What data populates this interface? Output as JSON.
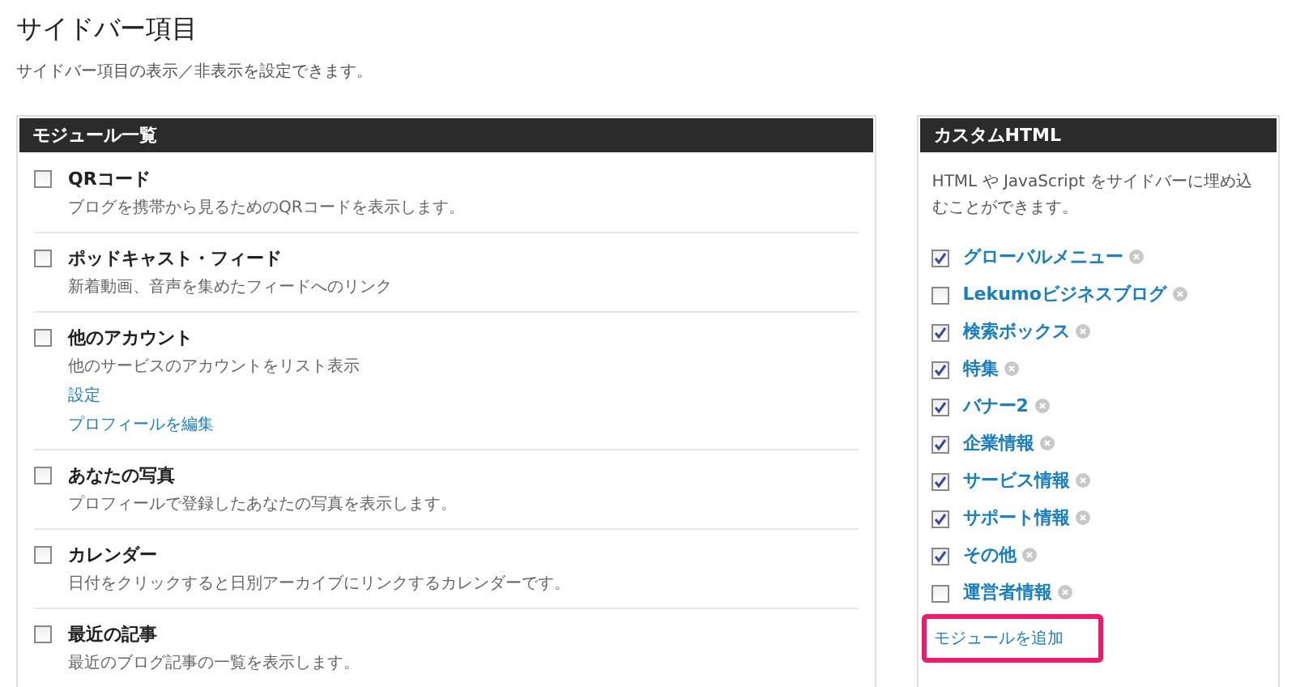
{
  "page": {
    "title": "サイドバー項目",
    "description": "サイドバー項目の表示／非表示を設定できます。"
  },
  "modules": {
    "title": "モジュール一覧",
    "items": [
      {
        "name": "QRコード",
        "checked": false,
        "description": "ブログを携帯から見るためのQRコードを表示します。"
      },
      {
        "name": "ポッドキャスト・フィード",
        "checked": false,
        "description": "新着動画、音声を集めたフィードへのリンク"
      },
      {
        "name": "他のアカウント",
        "checked": false,
        "description": "他のサービスのアカウントをリスト表示",
        "links": [
          "設定",
          "プロフィールを編集"
        ]
      },
      {
        "name": "あなたの写真",
        "checked": false,
        "description": "プロフィールで登録したあなたの写真を表示します。"
      },
      {
        "name": "カレンダー",
        "checked": false,
        "description": "日付をクリックすると日別アーカイブにリンクするカレンダーです。"
      },
      {
        "name": "最近の記事",
        "checked": false,
        "description": "最近のブログ記事の一覧を表示します。"
      }
    ]
  },
  "custom_html": {
    "title": "カスタムHTML",
    "description": "HTML や JavaScript をサイドバーに埋め込むことができます。",
    "items": [
      {
        "name": "グローバルメニュー",
        "checked": true
      },
      {
        "name": "Lekumoビジネスブログ",
        "checked": false
      },
      {
        "name": "検索ボックス",
        "checked": true
      },
      {
        "name": "特集",
        "checked": true
      },
      {
        "name": "バナー2",
        "checked": true
      },
      {
        "name": "企業情報",
        "checked": true
      },
      {
        "name": "サービス情報",
        "checked": true
      },
      {
        "name": "サポート情報",
        "checked": true
      },
      {
        "name": "その他",
        "checked": true
      },
      {
        "name": "運営者情報",
        "checked": false
      }
    ],
    "add_link": {
      "label": "モジュールを追加",
      "highlighted": true
    }
  }
}
